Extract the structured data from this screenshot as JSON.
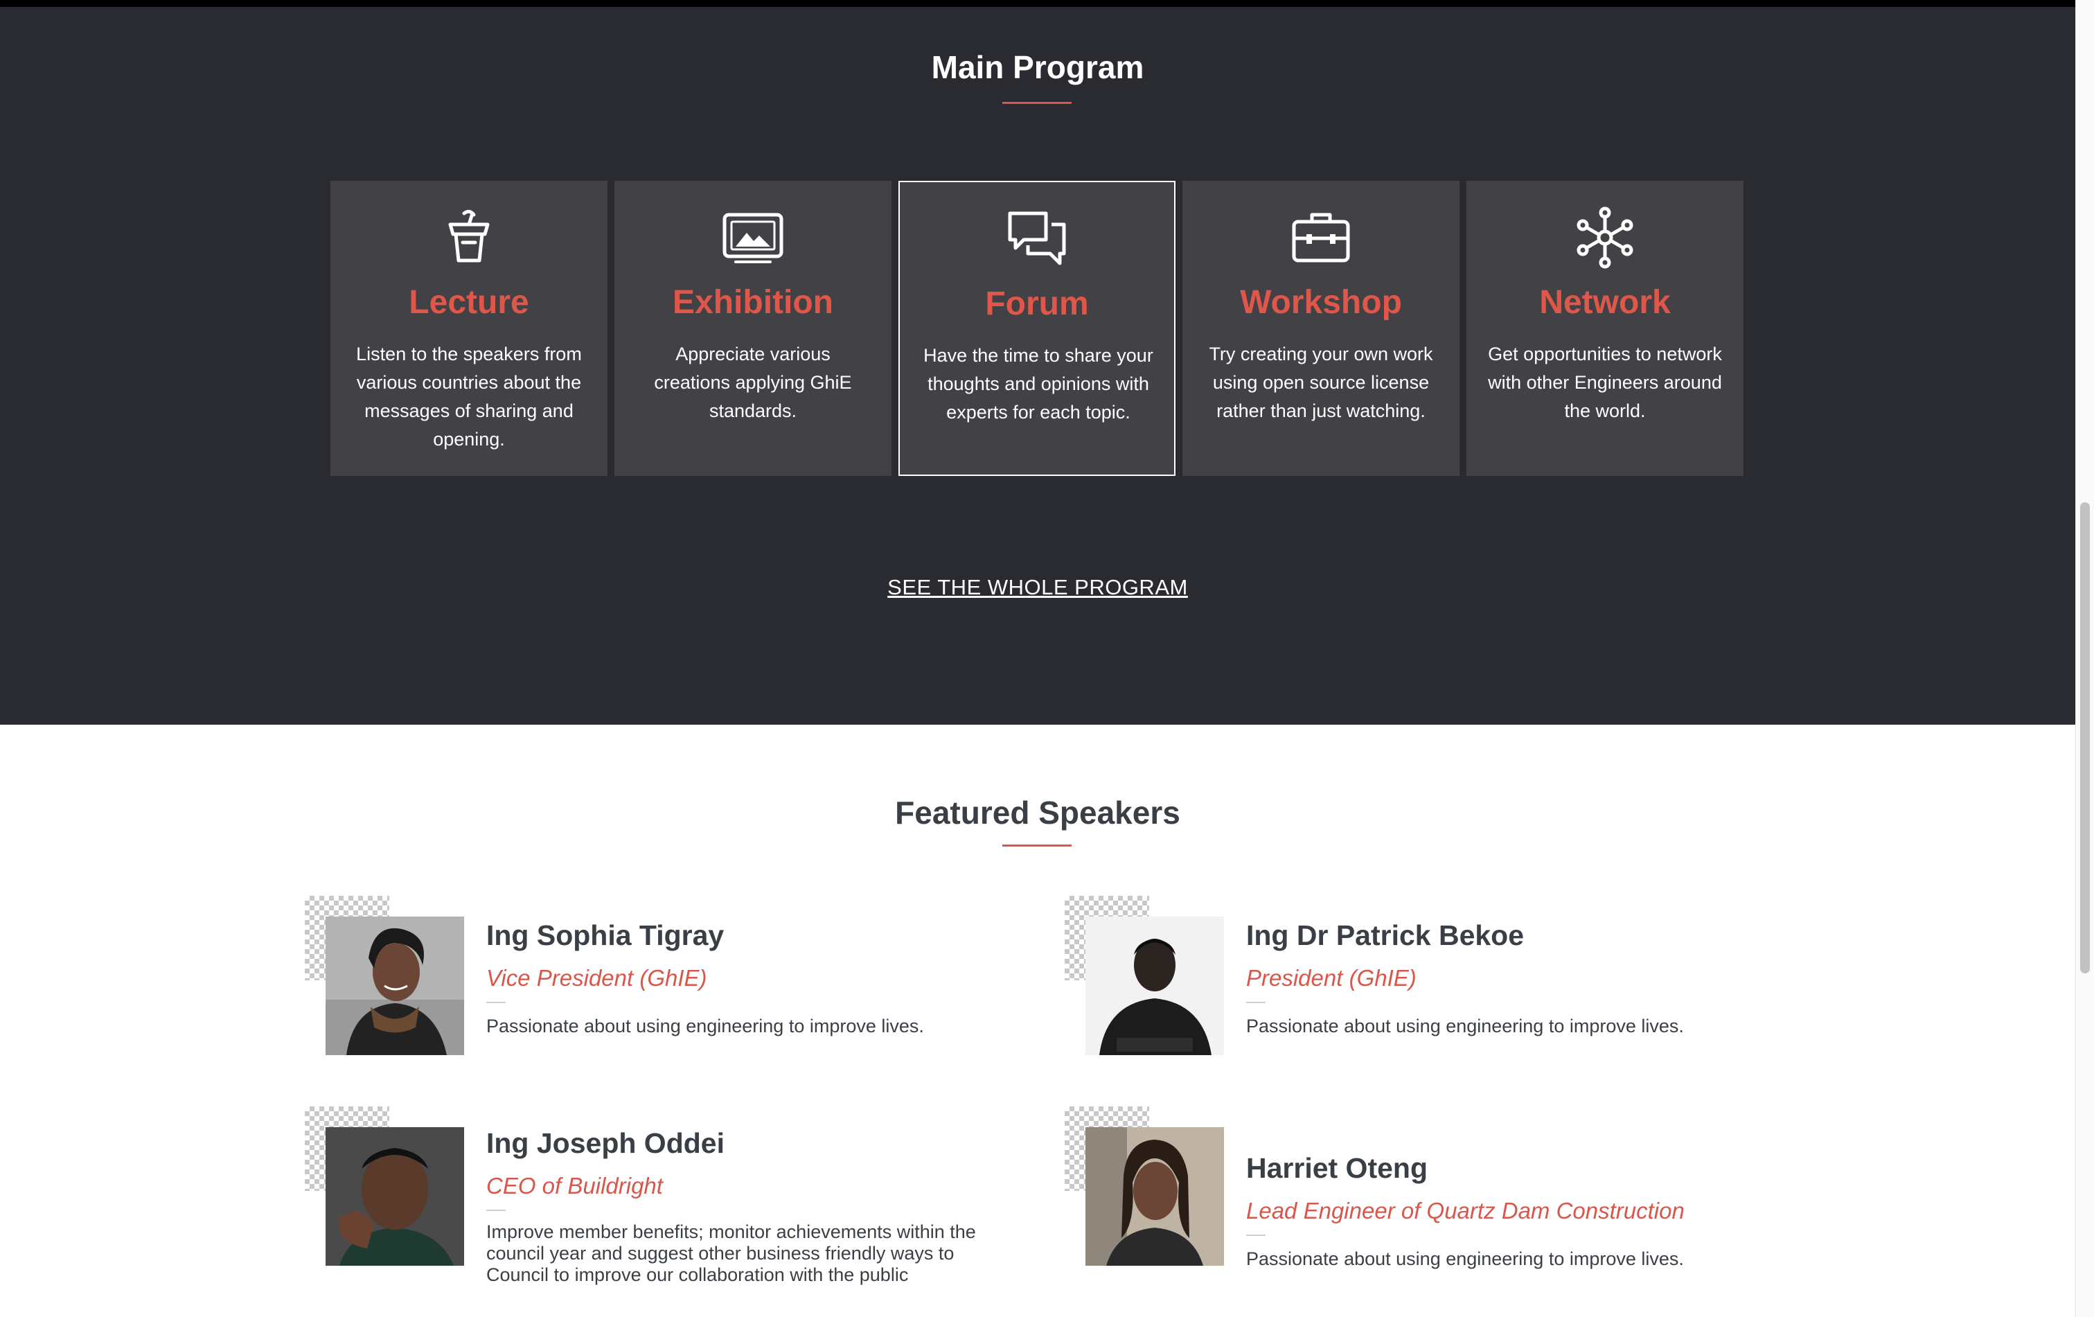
{
  "main_program": {
    "title": "Main Program",
    "cards": [
      {
        "icon": "podium-icon",
        "title": "Lecture",
        "description": "Listen to the speakers from various countries about the messages of sharing and opening."
      },
      {
        "icon": "picture-icon",
        "title": "Exhibition",
        "description": "Appreciate various creations applying GhiE standards."
      },
      {
        "icon": "chat-bubbles-icon",
        "title": "Forum",
        "description": "Have the time to share your thoughts and opinions with experts for each topic."
      },
      {
        "icon": "briefcase-icon",
        "title": "Workshop",
        "description": "Try creating your own work using open source license rather than just watching."
      },
      {
        "icon": "network-hub-icon",
        "title": "Network",
        "description": "Get opportunities to network with other Engineers around the world."
      }
    ],
    "link_label": "SEE THE WHOLE PROGRAM"
  },
  "featured_speakers": {
    "title": "Featured Speakers",
    "speakers": [
      {
        "name": "Ing Sophia Tigray",
        "role": "Vice President (GhIE)",
        "bio": "Passionate about using engineering to improve lives."
      },
      {
        "name": "Ing Dr Patrick Bekoe",
        "role": "President (GhIE)",
        "bio": "Passionate about using engineering to improve lives."
      },
      {
        "name": "Ing Joseph Oddei",
        "role": "CEO of Buildright",
        "bio": "Improve member benefits; monitor achievements within the council year and suggest other business friendly ways to Council to improve our collaboration with the public"
      },
      {
        "name": "Harriet Oteng",
        "role": "Lead Engineer of Quartz Dam Construction",
        "bio": "Passionate about using engineering to improve lives."
      }
    ]
  },
  "colors": {
    "accent": "#e0574a",
    "dark_background": "#2a2b30",
    "card_background": "#414146",
    "speaker_text": "#3a3f46"
  }
}
